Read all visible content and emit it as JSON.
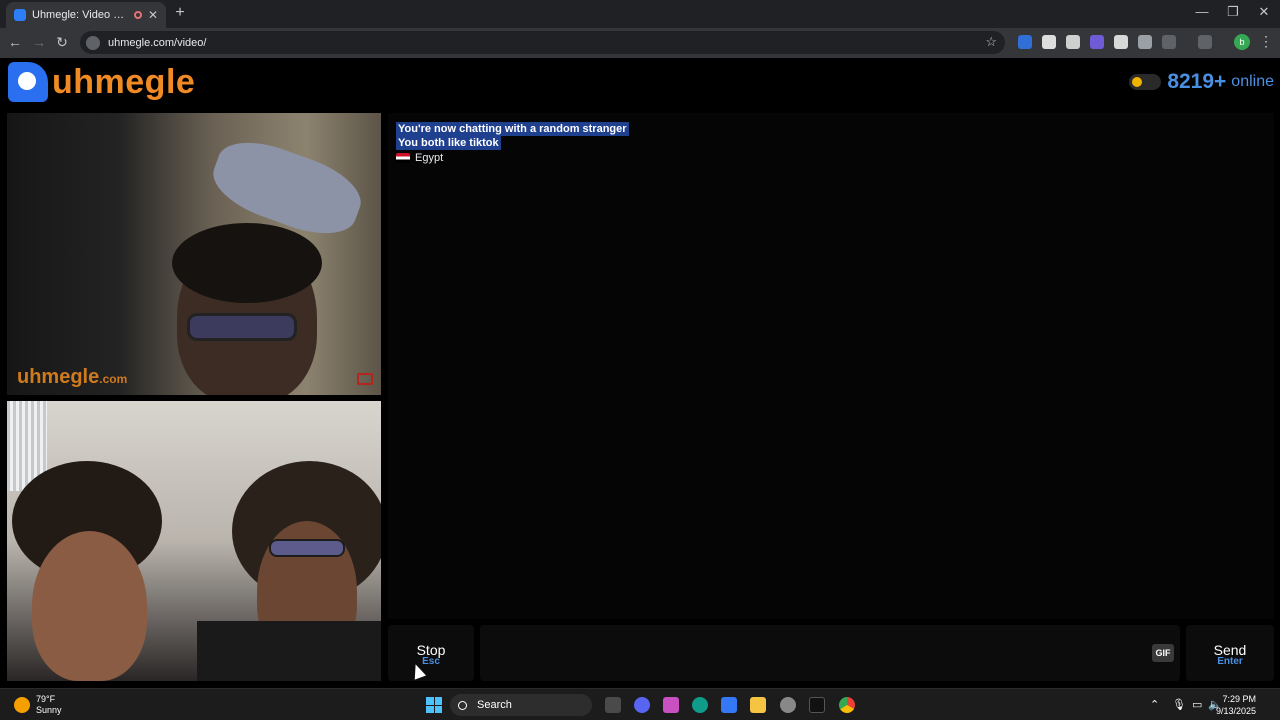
{
  "browser": {
    "tab_title": "Uhmegle: Video Chat | Ome...",
    "url": "uhmegle.com/video/",
    "profile_initial": "b"
  },
  "site": {
    "logo_text": "uhmegle",
    "online_count": "8219+",
    "online_label": "online"
  },
  "video": {
    "watermark": "uhmegle",
    "watermark_suffix": ".com"
  },
  "chat": {
    "messages": [
      "You're now chatting with a random stranger",
      "You both like tiktok"
    ],
    "country": "Egypt"
  },
  "controls": {
    "stop_label": "Stop",
    "stop_key": "Esc",
    "gif_label": "GIF",
    "send_label": "Send",
    "send_key": "Enter"
  },
  "taskbar": {
    "temperature": "79°F",
    "weather": "Sunny",
    "search_label": "Search",
    "time": "7:29 PM",
    "date": "9/13/2025"
  },
  "colors": {
    "brand_orange": "#f08a24",
    "brand_blue": "#4a90e2",
    "highlight": "#1f3f8f"
  }
}
